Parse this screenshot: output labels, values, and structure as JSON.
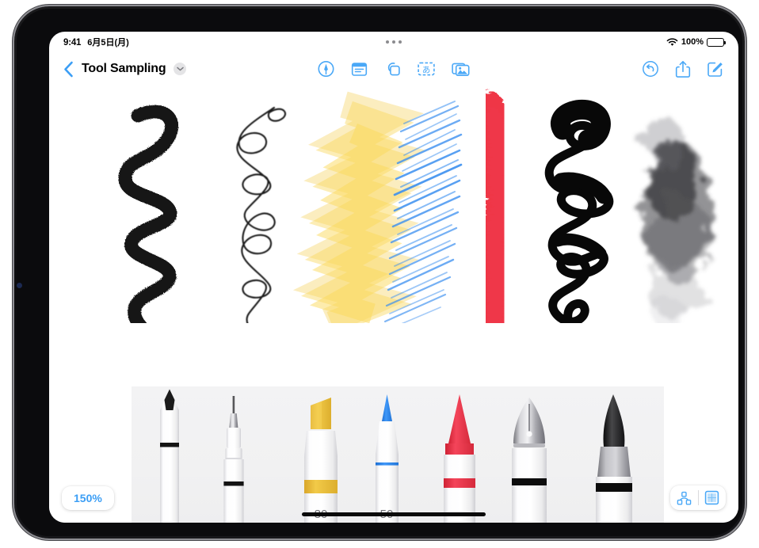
{
  "status_bar": {
    "time": "9:41",
    "date": "6月5日(月)",
    "battery_percent": "100%",
    "wifi_icon": "wifi-icon",
    "battery_icon": "battery-full-icon",
    "multitask_icon": "multitasking-dots-icon"
  },
  "toolbar": {
    "back_icon": "back-chevron-icon",
    "title": "Tool Sampling",
    "title_chevron_icon": "chevron-down-icon",
    "tools": [
      {
        "name": "markup-tool-icon",
        "label": "Markup"
      },
      {
        "name": "text-document-icon",
        "label": "Text"
      },
      {
        "name": "shapes-icon",
        "label": "Shapes"
      },
      {
        "name": "text-box-icon",
        "label": "あ"
      },
      {
        "name": "media-photos-icon",
        "label": "Media"
      }
    ],
    "actions": [
      {
        "name": "undo-icon",
        "label": "Undo"
      },
      {
        "name": "share-icon",
        "label": "Share"
      },
      {
        "name": "compose-icon",
        "label": "Compose"
      }
    ]
  },
  "canvas": {
    "strokes": [
      {
        "name": "pencil-stroke",
        "tool": "pencil",
        "color": "#111111"
      },
      {
        "name": "technical-pen-stroke",
        "tool": "technical-pen",
        "color": "#1a1a1a"
      },
      {
        "name": "highlighter-stroke",
        "tool": "highlighter",
        "color": "#f6cf4a"
      },
      {
        "name": "blue-pen-stroke",
        "tool": "blue-pen",
        "color": "#2e8ef0"
      },
      {
        "name": "crayon-stroke",
        "tool": "crayon",
        "color": "#ed2f3f"
      },
      {
        "name": "fountain-pen-stroke",
        "tool": "fountain-pen",
        "color": "#080808"
      },
      {
        "name": "watercolor-stroke",
        "tool": "watercolor",
        "color": "#55555a"
      }
    ],
    "tools": [
      {
        "name": "pencil-tool",
        "label": "",
        "tip_color": "#1b1b1b",
        "band_color": "#151515"
      },
      {
        "name": "technical-pen-tool",
        "label": "",
        "tip_color": "#6e6e72",
        "band_color": "#141414"
      },
      {
        "name": "highlighter-tool",
        "label": "80",
        "tip_color": "#eec23a",
        "band_color": "#edc23c"
      },
      {
        "name": "blue-pen-tool",
        "label": "50",
        "tip_color": "#2f8ef5",
        "band_color": "#2e7df0"
      },
      {
        "name": "crayon-tool",
        "label": "",
        "tip_color": "#ef3547",
        "band_color": "#ee3748"
      },
      {
        "name": "fountain-pen-tool",
        "label": "",
        "tip_color": "#9c9ca0",
        "band_color": "#0d0d0d"
      },
      {
        "name": "watercolor-brush-tool",
        "label": "",
        "tip_color": "#2a2a2c",
        "band_color": "#101010"
      }
    ]
  },
  "bottom_bar": {
    "zoom_level": "150%",
    "controls": [
      {
        "name": "path-nodes-icon",
        "label": "Nodes"
      },
      {
        "name": "canvas-grid-icon",
        "label": "Canvas"
      }
    ],
    "home_indicator": "home-indicator"
  },
  "colors": {
    "accent": "#3b9ef5",
    "tool_icon": "#4aa8f7",
    "screen_bg": "#ffffff",
    "palette_strip": "#f1f1f2"
  }
}
